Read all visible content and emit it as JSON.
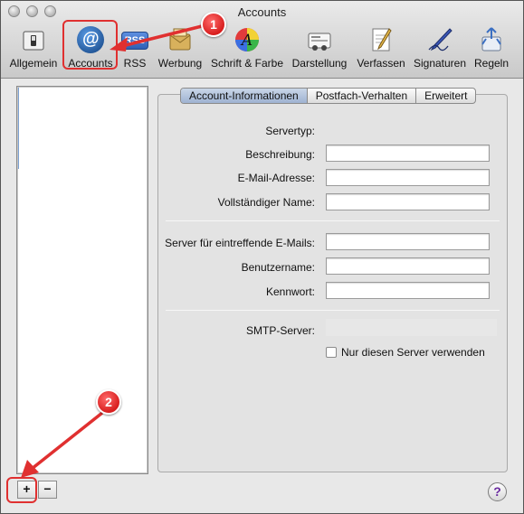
{
  "window": {
    "title": "Accounts"
  },
  "toolbar": {
    "items": [
      {
        "label": "Allgemein",
        "icon": "switch-icon"
      },
      {
        "label": "Accounts",
        "icon": "at-sign-icon"
      },
      {
        "label": "RSS",
        "icon": "rss-icon"
      },
      {
        "label": "Werbung",
        "icon": "junk-mail-icon"
      },
      {
        "label": "Schrift & Farbe",
        "icon": "font-color-icon"
      },
      {
        "label": "Darstellung",
        "icon": "display-icon"
      },
      {
        "label": "Verfassen",
        "icon": "compose-icon"
      },
      {
        "label": "Signaturen",
        "icon": "signature-icon"
      },
      {
        "label": "Regeln",
        "icon": "rules-icon"
      }
    ],
    "rss_icon_text": "RSS",
    "at_icon_text": "@"
  },
  "annotations": {
    "badge_1": "1",
    "badge_2": "2",
    "color": "#e03030"
  },
  "tabs": [
    {
      "label": "Account-Informationen",
      "selected": true
    },
    {
      "label": "Postfach-Verhalten",
      "selected": false
    },
    {
      "label": "Erweitert",
      "selected": false
    }
  ],
  "form": {
    "servertyp_label": "Servertyp:",
    "beschreibung_label": "Beschreibung:",
    "beschreibung_value": "",
    "email_label": "E-Mail-Adresse:",
    "email_value": "",
    "name_label": "Vollständiger Name:",
    "name_value": "",
    "incoming_label": "Server für eintreffende E-Mails:",
    "incoming_value": "",
    "username_label": "Benutzername:",
    "username_value": "",
    "password_label": "Kennwort:",
    "password_value": "",
    "smtp_label": "SMTP-Server:",
    "only_server_label": "Nur diesen Server verwenden"
  },
  "list_controls": {
    "add": "+",
    "remove": "−"
  },
  "help": {
    "label": "?"
  }
}
